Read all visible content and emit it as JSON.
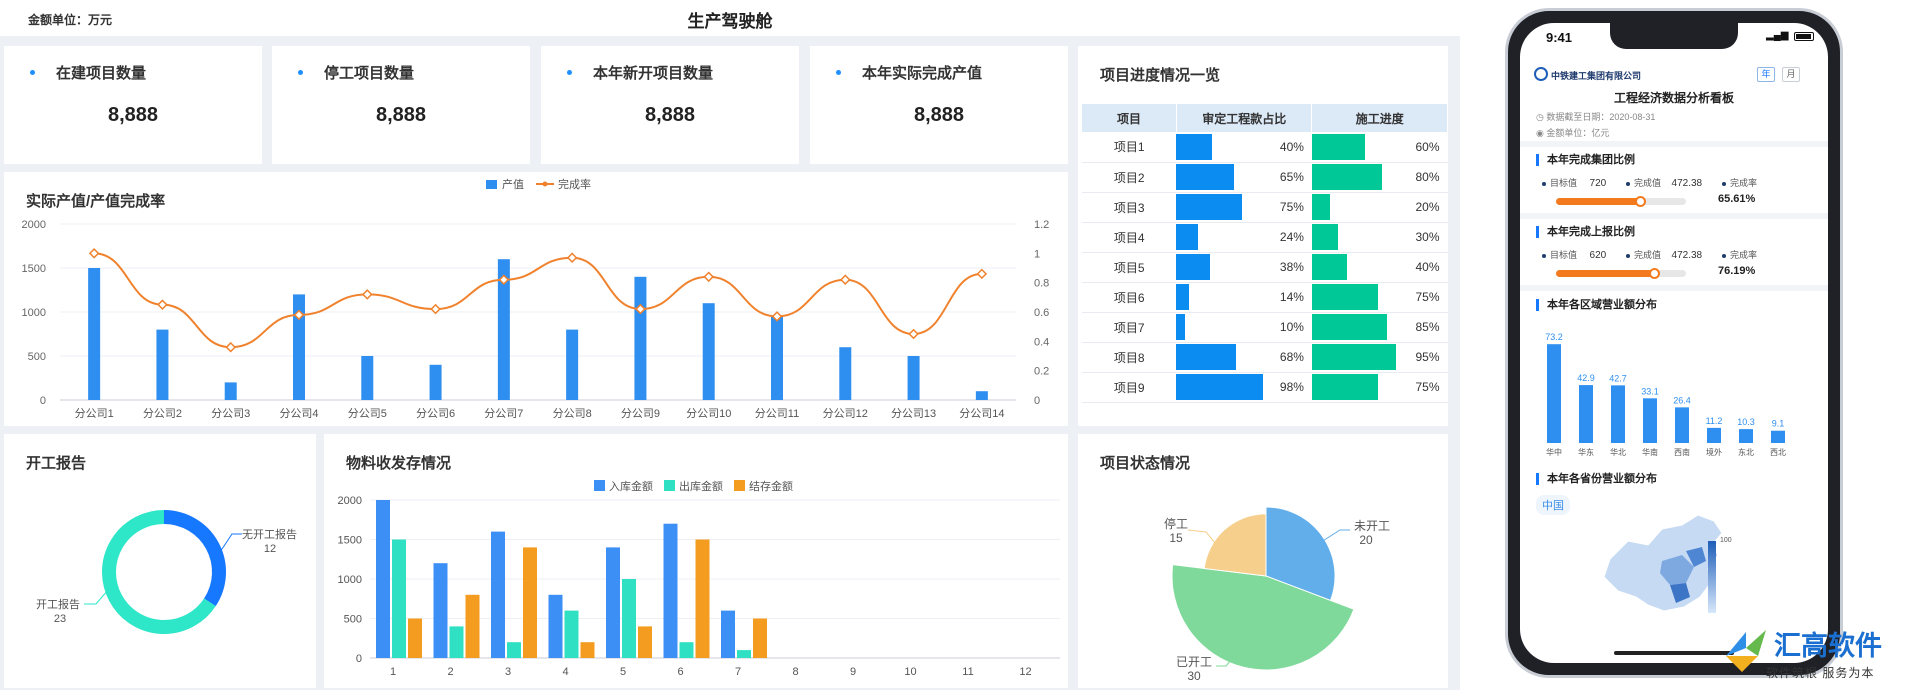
{
  "header": {
    "unit": "金额单位：万元",
    "title": "生产驾驶舱"
  },
  "kpis": [
    {
      "label": "在建项目数量",
      "value": "8,888"
    },
    {
      "label": "停工项目数量",
      "value": "8,888"
    },
    {
      "label": "本年新开项目数量",
      "value": "8,888"
    },
    {
      "label": "本年实际完成产值",
      "value": "8,888"
    }
  ],
  "output_panel": {
    "title": "实际产值/产值完成率"
  },
  "start_panel": {
    "title": "开工报告"
  },
  "material_panel": {
    "title": "物料收发存情况"
  },
  "progress_panel": {
    "title": "项目进度情况一览",
    "headers": [
      "项目",
      "审定工程款占比",
      "施工进度"
    ],
    "rows": [
      {
        "name": "项目1",
        "fund": "40%",
        "fund_v": 40,
        "build": "60%",
        "build_v": 60
      },
      {
        "name": "项目2",
        "fund": "65%",
        "fund_v": 65,
        "build": "80%",
        "build_v": 80
      },
      {
        "name": "项目3",
        "fund": "75%",
        "fund_v": 75,
        "build": "20%",
        "build_v": 20
      },
      {
        "name": "项目4",
        "fund": "24%",
        "fund_v": 24,
        "build": "30%",
        "build_v": 30
      },
      {
        "name": "项目5",
        "fund": "38%",
        "fund_v": 38,
        "build": "40%",
        "build_v": 40
      },
      {
        "name": "项目6",
        "fund": "14%",
        "fund_v": 14,
        "build": "75%",
        "build_v": 75
      },
      {
        "name": "项目7",
        "fund": "10%",
        "fund_v": 10,
        "build": "85%",
        "build_v": 85
      },
      {
        "name": "项目8",
        "fund": "68%",
        "fund_v": 68,
        "build": "95%",
        "build_v": 95
      },
      {
        "name": "项目9",
        "fund": "98%",
        "fund_v": 98,
        "build": "75%",
        "build_v": 75
      }
    ],
    "fund_color": "#0a8cf0",
    "build_color": "#00c896"
  },
  "status_panel": {
    "title": "项目状态情况"
  },
  "chart_data": [
    {
      "type": "bar",
      "categories": [
        "分公司1",
        "分公司2",
        "分公司3",
        "分公司4",
        "分公司5",
        "分公司6",
        "分公司7",
        "分公司8",
        "分公司9",
        "分公司10",
        "分公司11",
        "分公司12",
        "分公司13",
        "分公司14"
      ],
      "series": [
        {
          "name": "产值",
          "type": "bar",
          "axis": "left",
          "color": "#2e8ff0",
          "values": [
            1500,
            800,
            200,
            1200,
            500,
            400,
            1600,
            800,
            1400,
            1100,
            950,
            600,
            500,
            100
          ]
        },
        {
          "name": "完成率",
          "type": "line",
          "axis": "right",
          "color": "#f0822d",
          "values": [
            1.0,
            0.65,
            0.36,
            0.58,
            0.72,
            0.62,
            0.82,
            0.97,
            0.62,
            0.84,
            0.57,
            0.82,
            0.45,
            0.86
          ]
        }
      ],
      "y_left_ticks": [
        "0",
        "500",
        "1000",
        "1500",
        "2000"
      ],
      "y_right_ticks": [
        "0",
        "0.2",
        "0.4",
        "0.6",
        "0.8",
        "1",
        "1.2"
      ],
      "ylim_left": [
        0,
        2000
      ],
      "ylim_right": [
        0,
        1.2
      ],
      "legend": "top-center"
    },
    {
      "type": "pie",
      "style": "donut",
      "slices": [
        {
          "name": "无开工报告",
          "value": 12,
          "color": "#1677ff"
        },
        {
          "name": "开工报告",
          "value": 23,
          "color": "#2ee6c8"
        }
      ]
    },
    {
      "type": "bar",
      "categories": [
        "1",
        "2",
        "3",
        "4",
        "5",
        "6",
        "7",
        "8",
        "9",
        "10",
        "11",
        "12"
      ],
      "series": [
        {
          "name": "入库金额",
          "color": "#3b8ff5",
          "values": [
            2000,
            1200,
            1600,
            800,
            1400,
            1700,
            600,
            0,
            0,
            0,
            0,
            0
          ]
        },
        {
          "name": "出库金额",
          "color": "#2fe0c3",
          "values": [
            1500,
            400,
            200,
            600,
            1000,
            200,
            100,
            0,
            0,
            0,
            0,
            0
          ]
        },
        {
          "name": "结存金额",
          "color": "#f39c1f",
          "values": [
            500,
            800,
            1400,
            200,
            400,
            1500,
            500,
            0,
            0,
            0,
            0,
            0
          ]
        }
      ],
      "y_ticks": [
        "0",
        "500",
        "1000",
        "1500",
        "2000"
      ],
      "ylim": [
        0,
        2000
      ],
      "legend": "top-center"
    },
    {
      "type": "pie",
      "style": "rose",
      "slices": [
        {
          "name": "未开工",
          "value": 20,
          "color": "#62aeea"
        },
        {
          "name": "已开工",
          "value": 30,
          "color": "#7ed99a"
        },
        {
          "name": "停工",
          "value": 15,
          "color": "#f7cf8c"
        }
      ]
    },
    {
      "type": "bar",
      "categories": [
        "华中",
        "华东",
        "华北",
        "华南",
        "西南",
        "境外",
        "东北",
        "西北"
      ],
      "values": [
        73.2,
        42.9,
        42.7,
        33.1,
        26.4,
        11.2,
        10.3,
        9.1
      ],
      "labels": [
        "73.2",
        "42.9",
        "42.7",
        "33.1",
        "26.4",
        "11.2",
        "10.3",
        "9.1"
      ],
      "color": "#2e8ff0"
    }
  ],
  "phone": {
    "time": "9:41",
    "company": "中铁建工集团有限公司",
    "tab_year": "年",
    "tab_month": "月",
    "title": "工程经济数据分析看板",
    "date": "数据截至日期：2020-08-31",
    "unit": "金额单位：亿元",
    "sections": [
      {
        "title": "本年完成集团比例",
        "target_label": "目标值",
        "target": "720",
        "done_label": "完成值",
        "done": "472.38",
        "rate_label": "完成率",
        "rate": "65.61%",
        "rate_v": 65.61
      },
      {
        "title": "本年完成上报比例",
        "target_label": "目标值",
        "target": "620",
        "done_label": "完成值",
        "done": "472.38",
        "rate_label": "完成率",
        "rate": "76.19%",
        "rate_v": 76.19
      }
    ],
    "region_title": "本年各区域营业额分布",
    "province_title": "本年各省份营业额分布",
    "map_tag": "中国",
    "legend_max": "100",
    "accent": "#1677ff",
    "progress_color": "#f37b1d"
  },
  "watermark": {
    "brand": "汇高软件",
    "slogan": "软件筑根 服务为本"
  }
}
